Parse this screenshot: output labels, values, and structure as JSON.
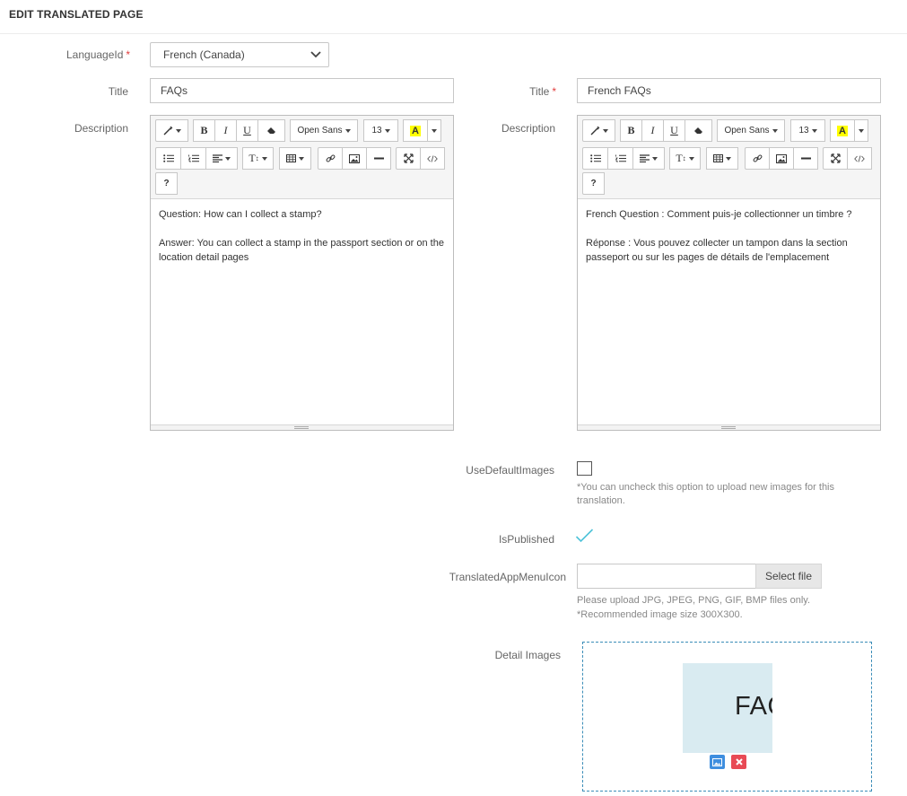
{
  "page": {
    "title": "EDIT TRANSLATED PAGE"
  },
  "left": {
    "language_label": "LanguageId",
    "language_value": "French (Canada)",
    "title_label": "Title",
    "title_value": "FAQs",
    "description_label": "Description",
    "description_lines": [
      "Question: How can I collect a stamp?",
      "Answer: You can collect a stamp in the passport section or on the location detail pages"
    ]
  },
  "right": {
    "title_label": "Title",
    "title_value": "French FAQs",
    "description_label": "Description",
    "description_lines": [
      "French Question : Comment puis-je collectionner un timbre ?",
      "Réponse : Vous pouvez collecter un tampon dans la section passeport ou sur les pages de détails de l'emplacement"
    ]
  },
  "toolbar": {
    "bold": "B",
    "italic": "I",
    "underline": "U",
    "font_name": "Open Sans",
    "font_size": "13",
    "highlight": "A",
    "style": "T",
    "help": "?"
  },
  "required_mark": "*",
  "options": {
    "use_default_images_label": "UseDefaultImages",
    "use_default_images_checked": false,
    "use_default_images_hint": "*You can uncheck this option to upload new images for this translation.",
    "is_published_label": "IsPublished",
    "is_published_checked": true,
    "menu_icon_label": "TranslatedAppMenuIcon",
    "select_file_label": "Select file",
    "upload_hint": "Please upload JPG, JPEG, PNG, GIF, BMP files only.",
    "size_hint": "*Recommended image size 300X300.",
    "detail_images_label": "Detail Images",
    "thumbnail_text": "FAQ"
  },
  "colors": {
    "accent": "#3e8edf",
    "danger": "#e84a55",
    "required": "#e23c3c",
    "check": "#4fc3d9"
  }
}
